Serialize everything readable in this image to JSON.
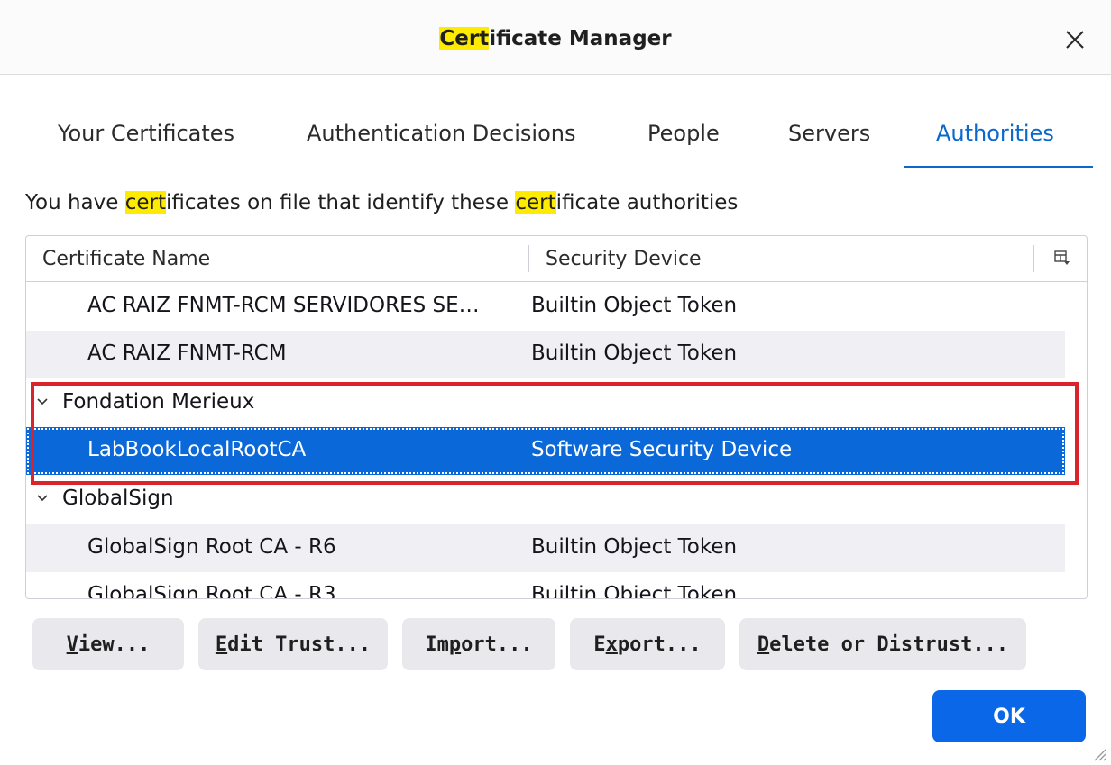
{
  "window": {
    "title_highlight": "Cert",
    "title_rest": "ificate Manager"
  },
  "tabs": [
    {
      "label": "Your Certificates",
      "active": false
    },
    {
      "label": "Authentication Decisions",
      "active": false
    },
    {
      "label": "People",
      "active": false
    },
    {
      "label": "Servers",
      "active": false
    },
    {
      "label": "Authorities",
      "active": true
    }
  ],
  "description": {
    "part1": "You have ",
    "hl1": "cert",
    "part2": "ificates on file that identify these ",
    "hl2": "cert",
    "part3": "ificate authorities"
  },
  "table": {
    "columns": [
      "Certificate Name",
      "Security Device"
    ],
    "rows": [
      {
        "type": "cert",
        "name": "AC RAIZ FNMT-RCM SERVIDORES SE…",
        "device": "Builtin Object Token"
      },
      {
        "type": "cert",
        "name": "AC RAIZ FNMT-RCM",
        "device": "Builtin Object Token"
      },
      {
        "type": "group",
        "name": "Fondation Merieux"
      },
      {
        "type": "cert",
        "name": "LabBookLocalRootCA",
        "device": "Software Security Device",
        "selected": true
      },
      {
        "type": "group",
        "name": "GlobalSign"
      },
      {
        "type": "cert",
        "name": "GlobalSign Root CA - R6",
        "device": "Builtin Object Token"
      },
      {
        "type": "cert",
        "name": "GlobalSign Root CA - R3",
        "device": "Builtin Object Token"
      }
    ]
  },
  "buttons": {
    "view": {
      "mnemonic": "V",
      "rest": "iew..."
    },
    "edit_trust": {
      "mnemonic": "E",
      "rest": "dit Trust..."
    },
    "import_pre": "Im",
    "import_mnemonic": "p",
    "import_rest": "ort...",
    "export_pre": "E",
    "export_mnemonic": "x",
    "export_rest": "port...",
    "delete": {
      "mnemonic": "D",
      "rest": "elete or Distrust..."
    },
    "ok": "OK"
  },
  "colors": {
    "accent": "#0a68cf",
    "selection": "#0a68d8",
    "highlight": "#ffeb00",
    "annotation_box": "#d9232d"
  }
}
